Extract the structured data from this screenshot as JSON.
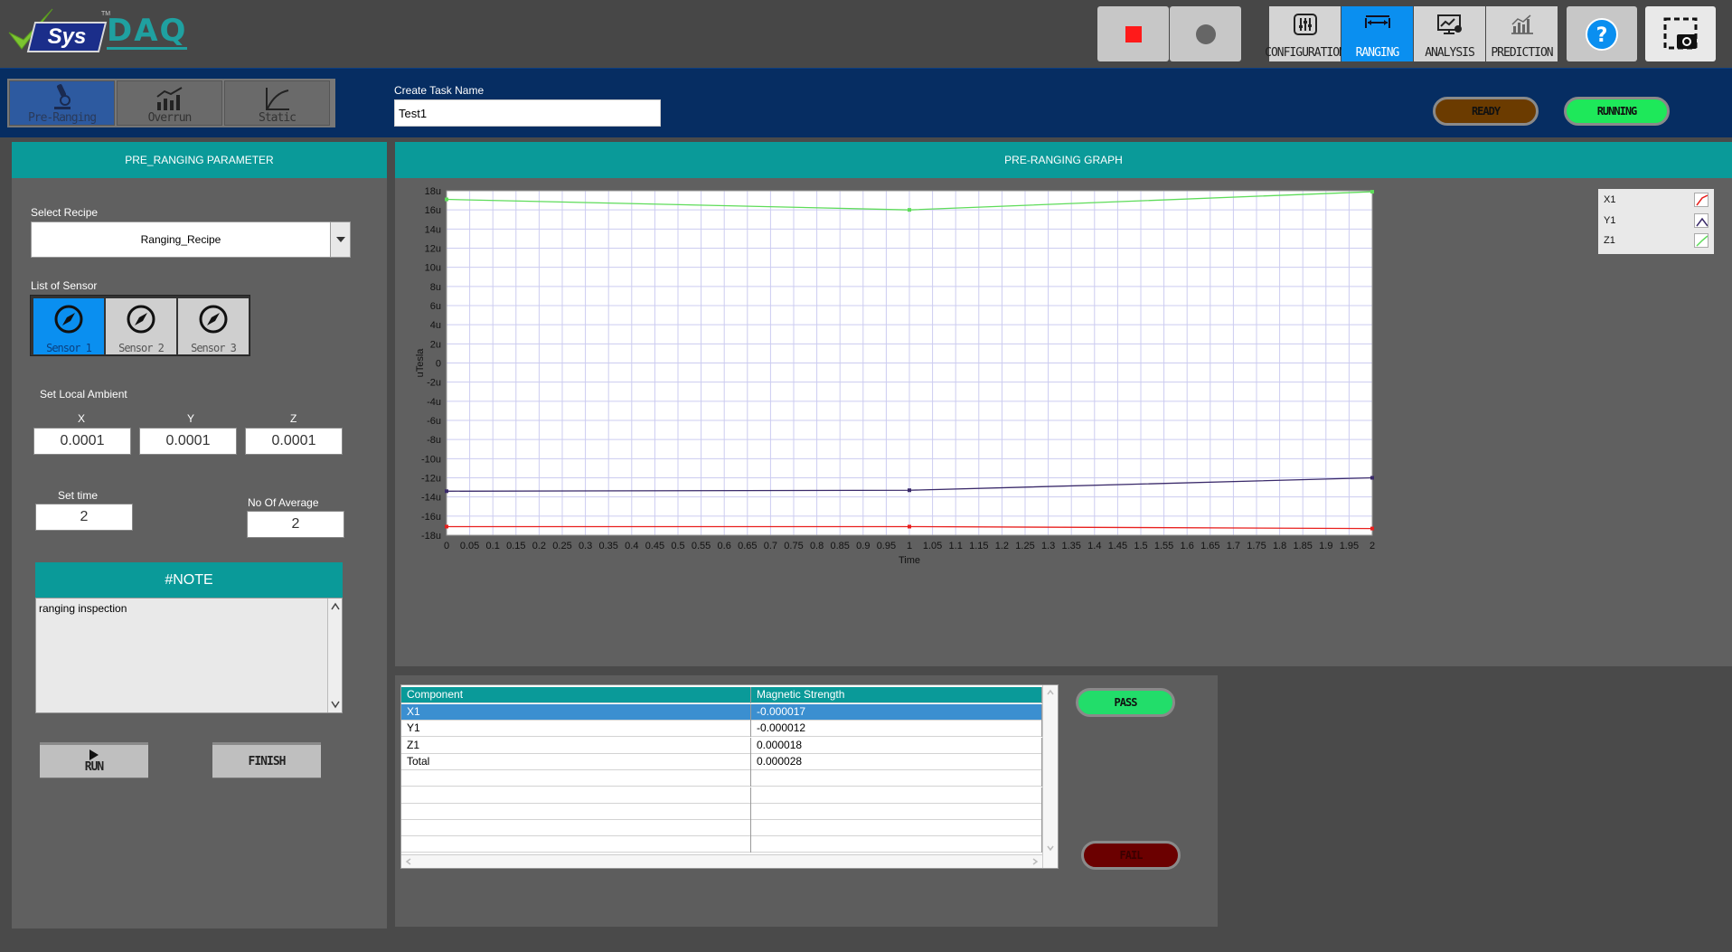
{
  "app": {
    "logo_sys": "Sys",
    "logo_daq": "DAQ",
    "logo_tm": "TM"
  },
  "toolbar": {
    "stop_icon": "stop-square-icon",
    "record_icon": "record-circle-icon",
    "nav": [
      {
        "label": "CONFIGURATION",
        "icon": "sliders-icon"
      },
      {
        "label": "RANGING",
        "icon": "range-icon"
      },
      {
        "label": "ANALYSIS",
        "icon": "analysis-monitor-icon"
      },
      {
        "label": "PREDICTION",
        "icon": "prediction-chart-icon"
      }
    ],
    "help_icon": "help-icon",
    "capture_icon": "camera-capture-icon",
    "active": "RANGING"
  },
  "modes": [
    {
      "label": "Pre-Ranging",
      "icon": "microscope-icon"
    },
    {
      "label": "Overrun",
      "icon": "bar-trend-icon"
    },
    {
      "label": "Static",
      "icon": "curve-icon"
    }
  ],
  "task": {
    "label": "Create Task Name",
    "value": "Test1"
  },
  "status": {
    "ready": "READY",
    "running": "RUNNING",
    "ready_color": "#6b3b00",
    "running_color": "#1ee85a"
  },
  "params": {
    "header": "PRE_RANGING PARAMETER",
    "recipe_label": "Select Recipe",
    "recipe_value": "Ranging_Recipe",
    "sensor_label": "List of Sensor",
    "sensors": [
      "Sensor 1",
      "Sensor 2",
      "Sensor 3"
    ],
    "ambient_label": "Set Local Ambient",
    "ambient": {
      "x_label": "X",
      "y_label": "Y",
      "z_label": "Z",
      "x": "0.0001",
      "y": "0.0001",
      "z": "0.0001"
    },
    "time_label": "Set time",
    "time_value": "2",
    "avg_label": "No Of Average",
    "avg_value": "2",
    "note_header": "#NOTE",
    "note_text": "ranging inspection",
    "run_label": "RUN",
    "finish_label": "FINISH"
  },
  "graph": {
    "header": "PRE-RANGING GRAPH"
  },
  "chart_data": {
    "type": "line",
    "xlabel": "Time",
    "ylabel": "uTesla",
    "xlim": [
      0,
      2
    ],
    "ylim": [
      -18,
      18
    ],
    "x_ticks": [
      "0",
      "0.05",
      "0.1",
      "0.15",
      "0.2",
      "0.25",
      "0.3",
      "0.35",
      "0.4",
      "0.45",
      "0.5",
      "0.55",
      "0.6",
      "0.65",
      "0.7",
      "0.75",
      "0.8",
      "0.85",
      "0.9",
      "0.95",
      "1",
      "1.05",
      "1.1",
      "1.15",
      "1.2",
      "1.25",
      "1.3",
      "1.35",
      "1.4",
      "1.45",
      "1.5",
      "1.55",
      "1.6",
      "1.65",
      "1.7",
      "1.75",
      "1.8",
      "1.85",
      "1.9",
      "1.95",
      "2"
    ],
    "y_ticks": [
      "18u",
      "16u",
      "14u",
      "12u",
      "10u",
      "8u",
      "6u",
      "4u",
      "2u",
      "0",
      "-2u",
      "-4u",
      "-6u",
      "-8u",
      "-10u",
      "-12u",
      "-14u",
      "-16u",
      "-18u"
    ],
    "x": [
      0,
      1,
      2
    ],
    "series": [
      {
        "name": "X1",
        "values": [
          -17.1,
          -17.1,
          -17.3
        ],
        "color": "#e8201e"
      },
      {
        "name": "Y1",
        "values": [
          -13.4,
          -13.3,
          -12.0
        ],
        "color": "#3a2a6a"
      },
      {
        "name": "Z1",
        "values": [
          17.1,
          16.0,
          17.9
        ],
        "color": "#5edc5a"
      }
    ],
    "grid": true,
    "legend": "right"
  },
  "table": {
    "headers": [
      "Component",
      "Magnetic Strength"
    ],
    "rows": [
      [
        "X1",
        "-0.000017"
      ],
      [
        "Y1",
        "-0.000012"
      ],
      [
        "Z1",
        "0.000018"
      ],
      [
        "Total",
        "0.000028"
      ]
    ],
    "empty_rows": 5,
    "selected": 0
  },
  "result": {
    "pass": "PASS",
    "fail": "FAIL",
    "pass_color": "#22dd6a",
    "fail_color": "#6b0000"
  }
}
